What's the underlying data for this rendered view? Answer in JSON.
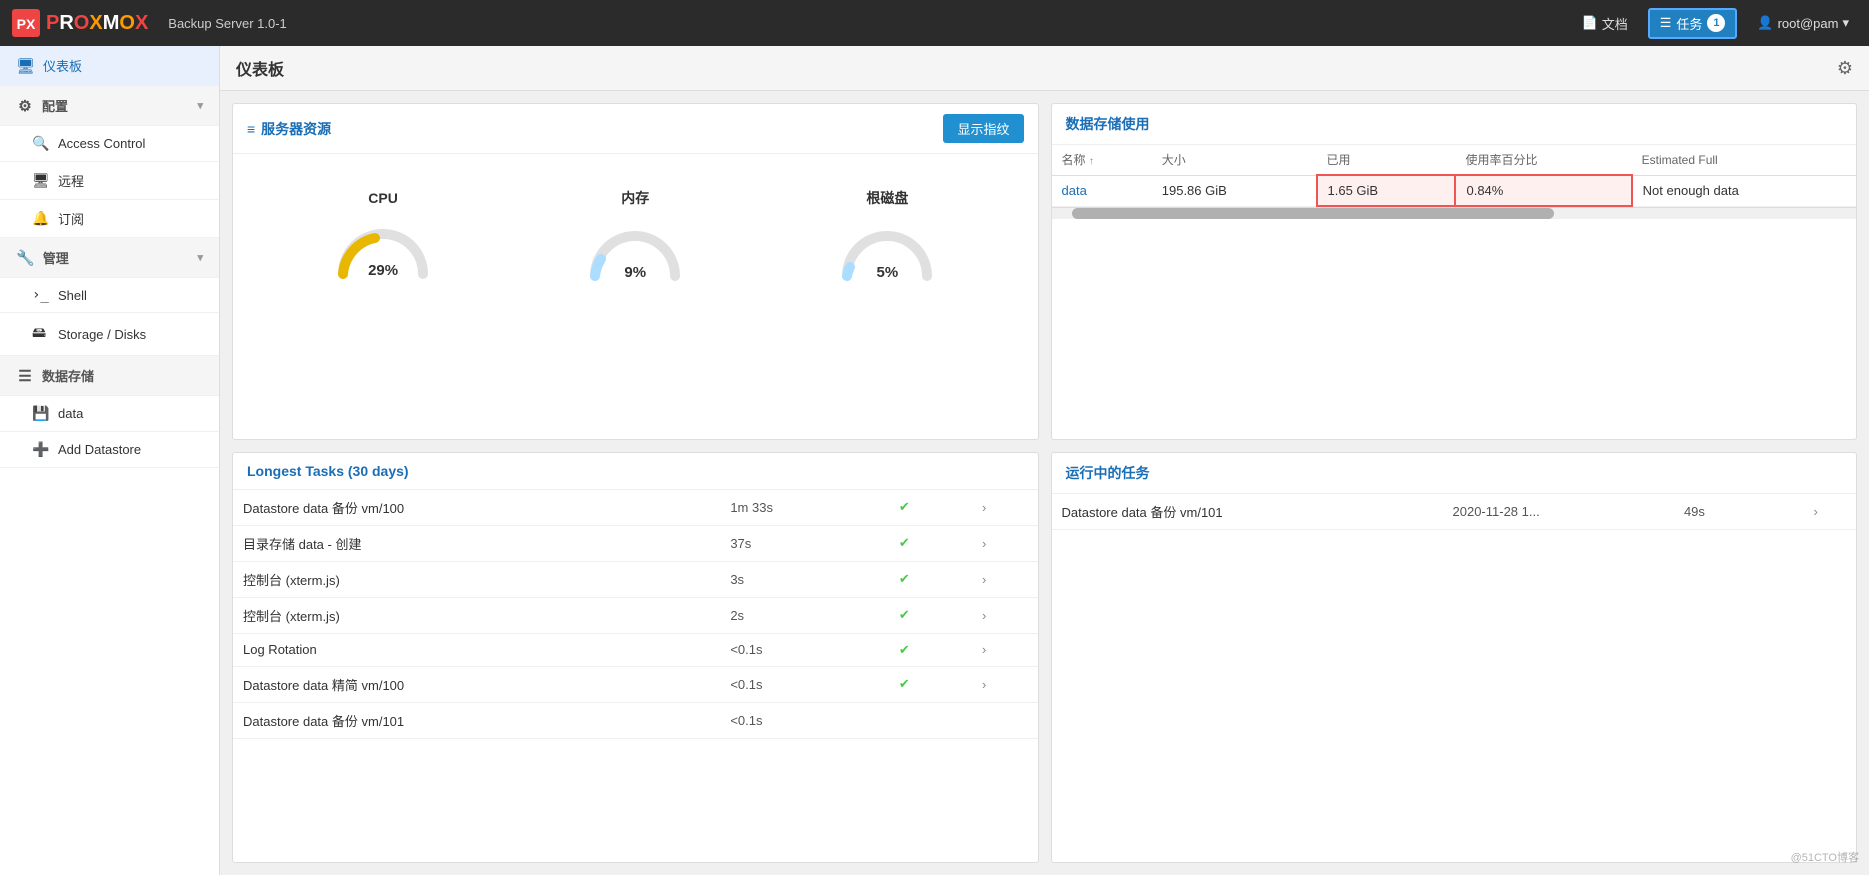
{
  "header": {
    "product": "PROXMOX",
    "subtitle": "Backup Server 1.0-1",
    "docs_label": "文档",
    "tasks_label": "任务",
    "tasks_count": "1",
    "user_label": "root@pam",
    "logo_letters": [
      "P",
      "R",
      "O",
      "X",
      "M",
      "O",
      "X"
    ]
  },
  "sidebar": {
    "dashboard_label": "仪表板",
    "config_label": "配置",
    "access_control_label": "Access Control",
    "remote_label": "远程",
    "subscription_label": "订阅",
    "management_label": "管理",
    "shell_label": "Shell",
    "storage_disks_label": "Storage / Disks",
    "data_storage_label": "数据存储",
    "data_label": "data",
    "add_datastore_label": "Add Datastore"
  },
  "page": {
    "title": "仪表板"
  },
  "server_resources": {
    "title": "服务器资源",
    "show_metrics_label": "显示指纹",
    "cpu_label": "CPU",
    "memory_label": "内存",
    "disk_label": "根磁盘",
    "cpu_percent": 29,
    "memory_percent": 9,
    "disk_percent": 5,
    "cpu_display": "29%",
    "memory_display": "9%",
    "disk_display": "5%"
  },
  "data_storage": {
    "title": "数据存储使用",
    "columns": {
      "name": "名称",
      "size": "大小",
      "used": "已用",
      "usage_pct": "使用率百分比",
      "estimated_full": "Estimated Full"
    },
    "rows": [
      {
        "name": "data",
        "size": "195.86 GiB",
        "used": "1.65 GiB",
        "usage_pct": "0.84%",
        "estimated_full": "Not enough data"
      }
    ]
  },
  "longest_tasks": {
    "title": "Longest Tasks (30 days)",
    "rows": [
      {
        "name": "Datastore data 备份 vm/100",
        "duration": "1m 33s",
        "status": "ok"
      },
      {
        "name": "目录存储 data - 创建",
        "duration": "37s",
        "status": "ok"
      },
      {
        "name": "控制台 (xterm.js)",
        "duration": "3s",
        "status": "ok"
      },
      {
        "name": "控制台 (xterm.js)",
        "duration": "2s",
        "status": "ok"
      },
      {
        "name": "Log Rotation",
        "duration": "<0.1s",
        "status": "ok"
      },
      {
        "name": "Datastore data 精简 vm/100",
        "duration": "<0.1s",
        "status": "ok"
      },
      {
        "name": "Datastore data 备份 vm/101",
        "duration": "<0.1s",
        "status": ""
      }
    ]
  },
  "running_tasks": {
    "title": "运行中的任务",
    "rows": [
      {
        "name": "Datastore data 备份 vm/101",
        "time": "2020-11-28 1...",
        "duration": "49s"
      }
    ]
  },
  "watermark": "@51CTO博客"
}
